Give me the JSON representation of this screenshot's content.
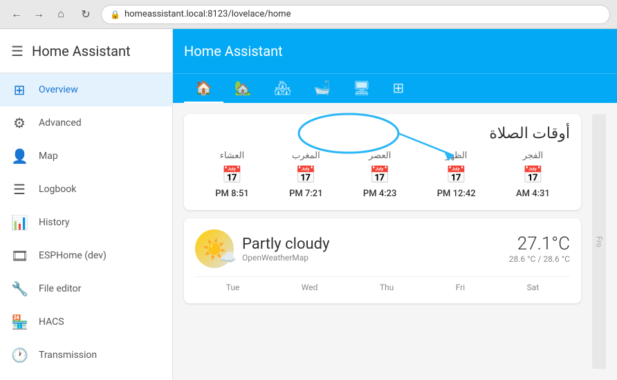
{
  "browser": {
    "url": "homeassistant.local:8123/lovelace/home",
    "back_label": "←",
    "forward_label": "→",
    "home_label": "⌂",
    "reload_label": "↻",
    "secure_icon": "🔒"
  },
  "sidebar": {
    "title": "Home Assistant",
    "menu_icon": "☰",
    "items": [
      {
        "id": "overview",
        "label": "Overview",
        "icon": "⊞",
        "active": true
      },
      {
        "id": "advanced",
        "label": "Advanced",
        "icon": "⚙",
        "active": false
      },
      {
        "id": "map",
        "label": "Map",
        "icon": "👤",
        "active": false
      },
      {
        "id": "logbook",
        "label": "Logbook",
        "icon": "☰",
        "active": false
      },
      {
        "id": "history",
        "label": "History",
        "icon": "📊",
        "active": false
      },
      {
        "id": "esphome",
        "label": "ESPHome (dev)",
        "icon": "🎞",
        "active": false
      },
      {
        "id": "file-editor",
        "label": "File editor",
        "icon": "🔧",
        "active": false
      },
      {
        "id": "hacs",
        "label": "HACS",
        "icon": "🏪",
        "active": false
      },
      {
        "id": "transmission",
        "label": "Transmission",
        "icon": "🕐",
        "active": false
      }
    ]
  },
  "header": {
    "title": "Home Assistant",
    "tabs": [
      {
        "icon": "🏠",
        "active": true
      },
      {
        "icon": "🏡",
        "active": false
      },
      {
        "icon": "🏘",
        "active": false
      },
      {
        "icon": "🛁",
        "active": false
      },
      {
        "icon": "🖥",
        "active": false
      },
      {
        "icon": "⊞",
        "active": false
      }
    ]
  },
  "prayer_card": {
    "title": "أوقات الصلاة",
    "times": [
      {
        "name": "الفجر",
        "time": "4:31 AM"
      },
      {
        "name": "الظهر",
        "time": "12:42 PM"
      },
      {
        "name": "العصر",
        "time": "4:23 PM"
      },
      {
        "name": "المغرب",
        "time": "7:21 PM"
      },
      {
        "name": "العشاء",
        "time": "8:51 PM"
      }
    ]
  },
  "weather_card": {
    "condition": "Partly cloudy",
    "source": "OpenWeatherMap",
    "temperature": "27.1°C",
    "range": "28.6 °C / 28.6 °C",
    "days": [
      "Tue",
      "Wed",
      "Thu",
      "Fri",
      "Sat"
    ]
  },
  "right_panel": {
    "hint": "Fro..."
  }
}
